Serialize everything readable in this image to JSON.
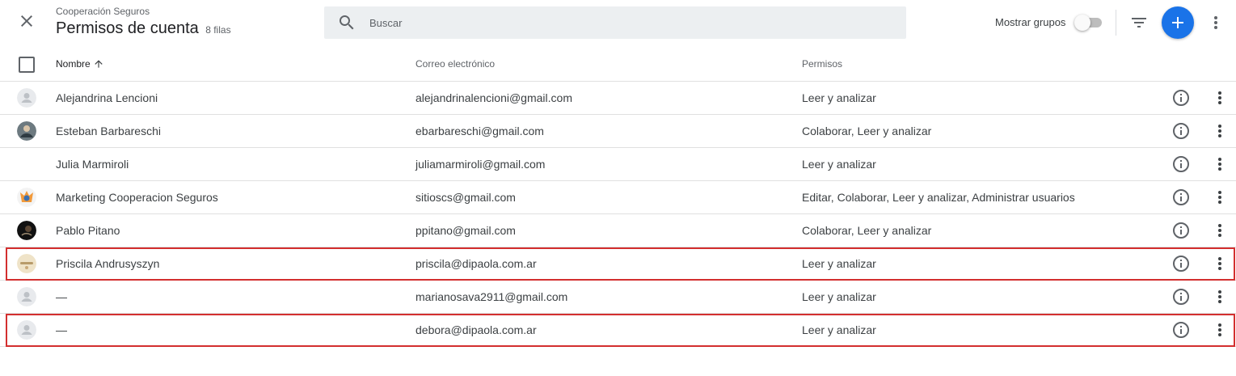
{
  "header": {
    "account_name": "Cooperación Seguros",
    "title": "Permisos de cuenta",
    "row_count": "8 filas",
    "close_icon": "close-icon",
    "search": {
      "placeholder": "Buscar",
      "value": "",
      "icon": "search-icon"
    },
    "show_groups_label": "Mostrar grupos",
    "show_groups_on": false,
    "filter_icon": "filter-icon",
    "add_icon": "plus-icon",
    "more_icon": "more-vert-icon"
  },
  "table": {
    "columns": {
      "name": "Nombre",
      "email": "Correo electrónico",
      "permissions": "Permisos"
    },
    "sort": {
      "column": "name",
      "direction": "ascending",
      "icon": "arrow-up-icon"
    },
    "rows": [
      {
        "name": "Alejandrina Lencioni",
        "email": "alejandrinalencioni@gmail.com",
        "permissions": "Leer y analizar",
        "avatar": "default-person",
        "highlighted": false
      },
      {
        "name": "Esteban Barbareschi",
        "email": "ebarbareschi@gmail.com",
        "permissions": "Colaborar, Leer y analizar",
        "avatar": "photo",
        "highlighted": false
      },
      {
        "name": "Julia Marmiroli",
        "email": "juliamarmiroli@gmail.com",
        "permissions": "Leer y analizar",
        "avatar": "none",
        "highlighted": false
      },
      {
        "name": "Marketing Cooperacion Seguros",
        "email": "sitioscs@gmail.com",
        "permissions": "Editar, Colaborar, Leer y analizar, Administrar usuarios",
        "avatar": "photo",
        "highlighted": false
      },
      {
        "name": "Pablo Pitano",
        "email": "ppitano@gmail.com",
        "permissions": "Colaborar, Leer y analizar",
        "avatar": "photo",
        "highlighted": false
      },
      {
        "name": "Priscila Andrusyszyn",
        "email": "priscila@dipaola.com.ar",
        "permissions": "Leer y analizar",
        "avatar": "photo",
        "highlighted": true
      },
      {
        "name": "—",
        "email": "marianosava2911@gmail.com",
        "permissions": "Leer y analizar",
        "avatar": "default-person",
        "highlighted": false
      },
      {
        "name": "—",
        "email": "debora@dipaola.com.ar",
        "permissions": "Leer y analizar",
        "avatar": "default-person",
        "highlighted": true
      }
    ]
  },
  "colors": {
    "accent": "#1a73e8",
    "highlight_border": "#d32f2f",
    "search_bg": "#eceff1",
    "divider": "#e0e0e0"
  }
}
